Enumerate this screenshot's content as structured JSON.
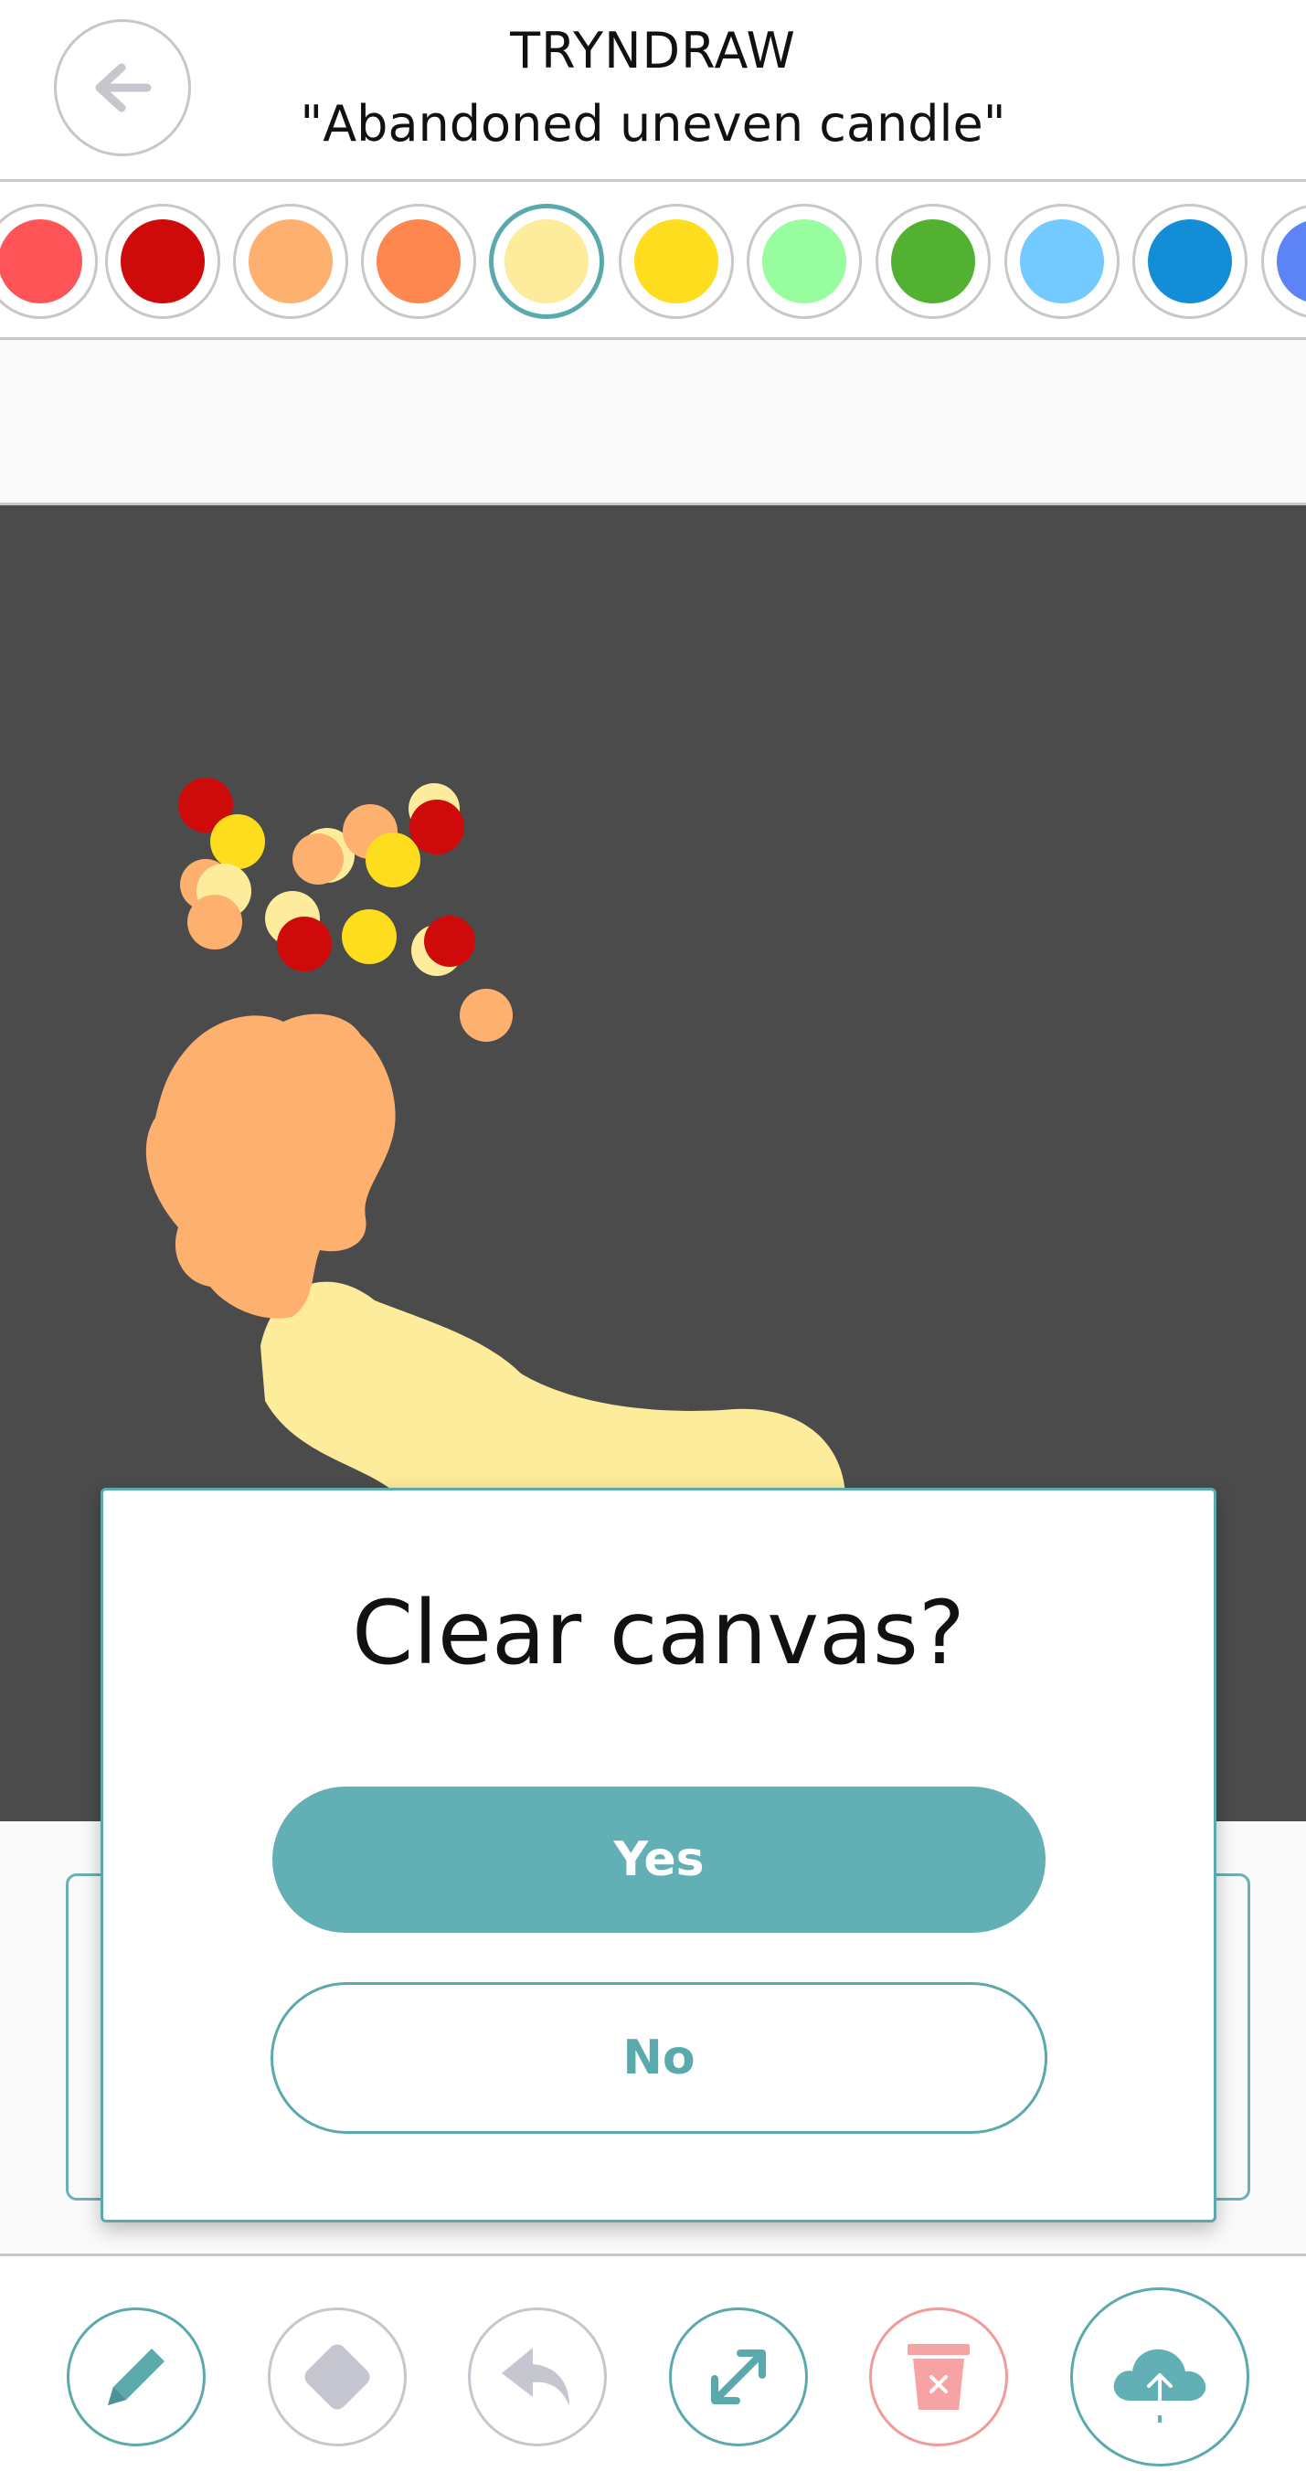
{
  "header": {
    "back_icon": "arrow-left-icon",
    "app_title": "TRYNDRAW",
    "prompt": "\"Abandoned uneven candle\""
  },
  "palette": {
    "selected_index": 4,
    "colors": [
      "#fe5458",
      "#cf0a0a",
      "#feb06f",
      "#fe8750",
      "#fdec9b",
      "#fedd1f",
      "#97fd9e",
      "#52b131",
      "#72cafe",
      "#138ed6",
      "#5d84f6"
    ]
  },
  "canvas": {
    "background": "#4b4b4b"
  },
  "dialog": {
    "title": "Clear canvas?",
    "yes_label": "Yes",
    "no_label": "No"
  },
  "toolbar": {
    "tools": [
      "pencil-icon",
      "eraser-icon",
      "undo-icon",
      "expand-icon",
      "trash-icon",
      "cloud-upload-icon"
    ]
  },
  "colors": {
    "accent": "#5aa9ad",
    "accent_fill": "#62b0b5",
    "danger": "#f29a9a"
  }
}
